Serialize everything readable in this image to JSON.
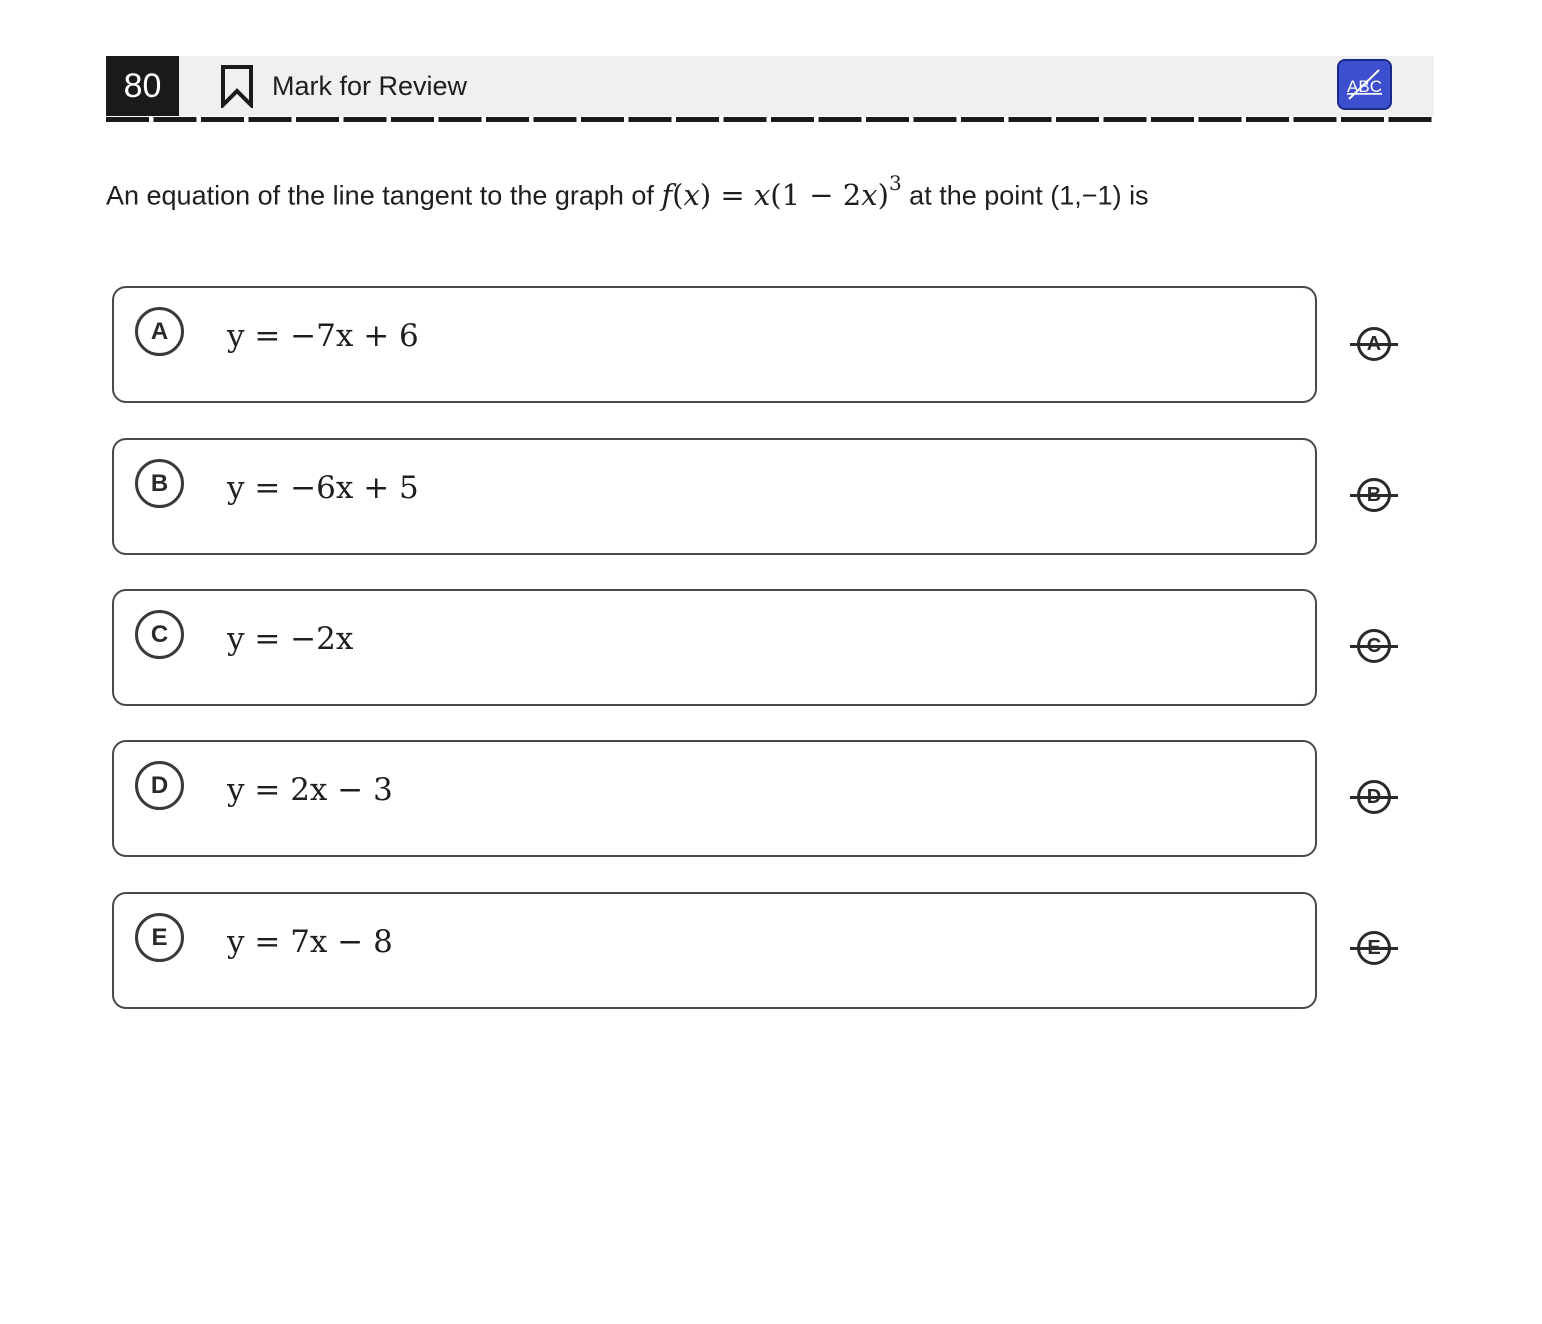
{
  "header": {
    "question_number": "80",
    "mark_for_review_label": "Mark for Review",
    "bookmark_icon": "bookmark-icon",
    "abc_button_icon": "abc-strikethrough-icon",
    "abc_button_text": "ABC",
    "abc_button_color": "#3d4fce"
  },
  "question": {
    "prefix": "An equation of the line tangent to the graph of ",
    "suffix": " at the point (1,−1) is",
    "math": {
      "f": "f",
      "x1": "x",
      "equals": " = ",
      "x2": "x",
      "open": "(1 − 2",
      "x3": "x",
      "close": ")",
      "exponent": "3"
    }
  },
  "choices": [
    {
      "letter": "A",
      "equation": "y = −7x + 6",
      "strike_label": "A"
    },
    {
      "letter": "B",
      "equation": "y = −6x + 5",
      "strike_label": "B"
    },
    {
      "letter": "C",
      "equation": "y = −2x",
      "strike_label": "C"
    },
    {
      "letter": "D",
      "equation": "y = 2x − 3",
      "strike_label": "D"
    },
    {
      "letter": "E",
      "equation": "y = 7x − 8",
      "strike_label": "E"
    }
  ]
}
